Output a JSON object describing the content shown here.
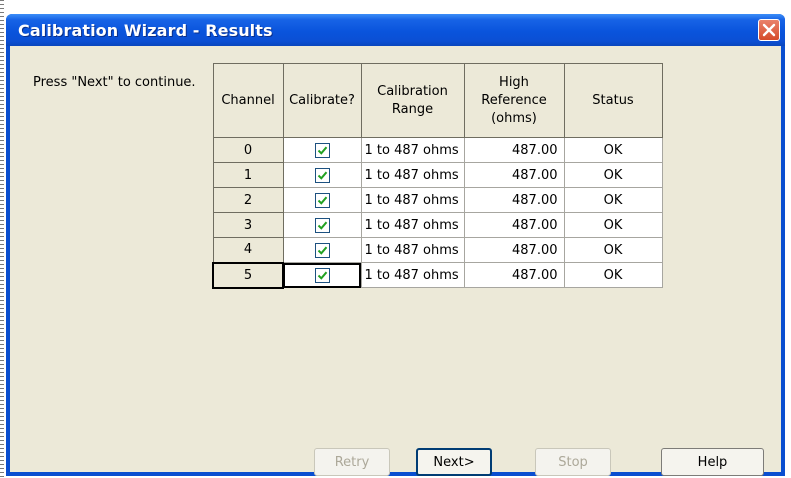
{
  "window": {
    "title": "Calibration Wizard - Results"
  },
  "prompt_text": "Press \"Next\" to continue.",
  "table": {
    "headers": {
      "channel": "Channel",
      "calibrate": "Calibrate?",
      "range_line1": "Calibration",
      "range_line2": "Range",
      "high_line1": "High",
      "high_line2": "Reference",
      "high_line3": "(ohms)",
      "status": "Status"
    },
    "rows": [
      {
        "channel": "0",
        "calibrate": true,
        "range": "1 to 487 ohms",
        "high": "487.00",
        "status": "OK"
      },
      {
        "channel": "1",
        "calibrate": true,
        "range": "1 to 487 ohms",
        "high": "487.00",
        "status": "OK"
      },
      {
        "channel": "2",
        "calibrate": true,
        "range": "1 to 487 ohms",
        "high": "487.00",
        "status": "OK"
      },
      {
        "channel": "3",
        "calibrate": true,
        "range": "1 to 487 ohms",
        "high": "487.00",
        "status": "OK"
      },
      {
        "channel": "4",
        "calibrate": true,
        "range": "1 to 487 ohms",
        "high": "487.00",
        "status": "OK"
      },
      {
        "channel": "5",
        "calibrate": true,
        "range": "1 to 487 ohms",
        "high": "487.00",
        "status": "OK"
      }
    ]
  },
  "buttons": {
    "retry": "Retry",
    "next": "Next>",
    "stop": "Stop",
    "help": "Help"
  },
  "colors": {
    "titlebar": "#0a54dc",
    "dialog_bg": "#ece9d8",
    "check": "#21a121",
    "close": "#d64b2a"
  }
}
